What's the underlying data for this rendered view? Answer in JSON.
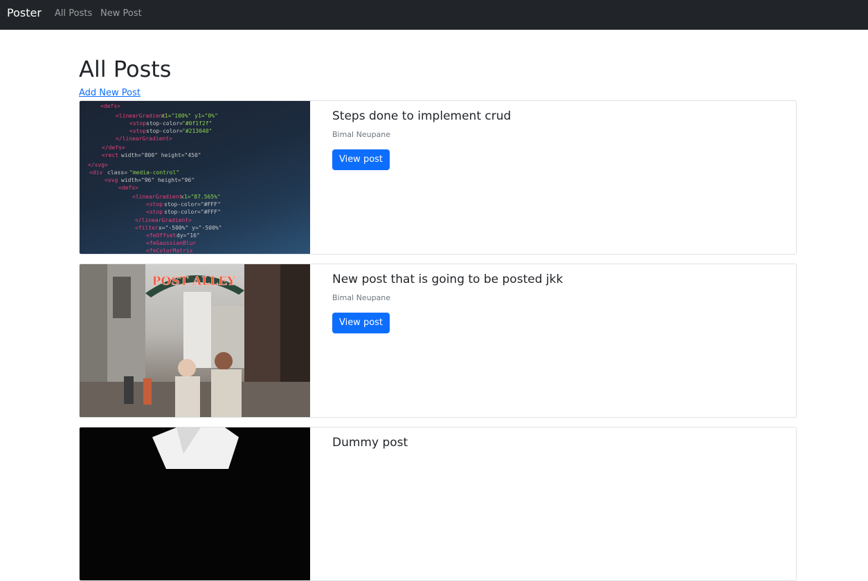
{
  "navbar": {
    "brand": "Poster",
    "links": [
      {
        "label": "All Posts"
      },
      {
        "label": "New Post"
      }
    ]
  },
  "main": {
    "title": "All Posts",
    "add_link": "Add New Post"
  },
  "posts": [
    {
      "title": "Steps done to implement crud",
      "author": "Bimal Neupane",
      "button": "View post",
      "image": "code-screen-image"
    },
    {
      "title": "New post that is going to be posted jkk",
      "author": "Bimal Neupane",
      "button": "View post",
      "image": "post-alley-street-image"
    },
    {
      "title": "Dummy post",
      "author": "",
      "button": "",
      "image": "dark-image"
    }
  ],
  "image_text": {
    "alley_sign": "POST ALLEY"
  },
  "colors": {
    "navbar_bg": "#212529",
    "primary": "#0d6efd",
    "link": "#0d6efd"
  }
}
